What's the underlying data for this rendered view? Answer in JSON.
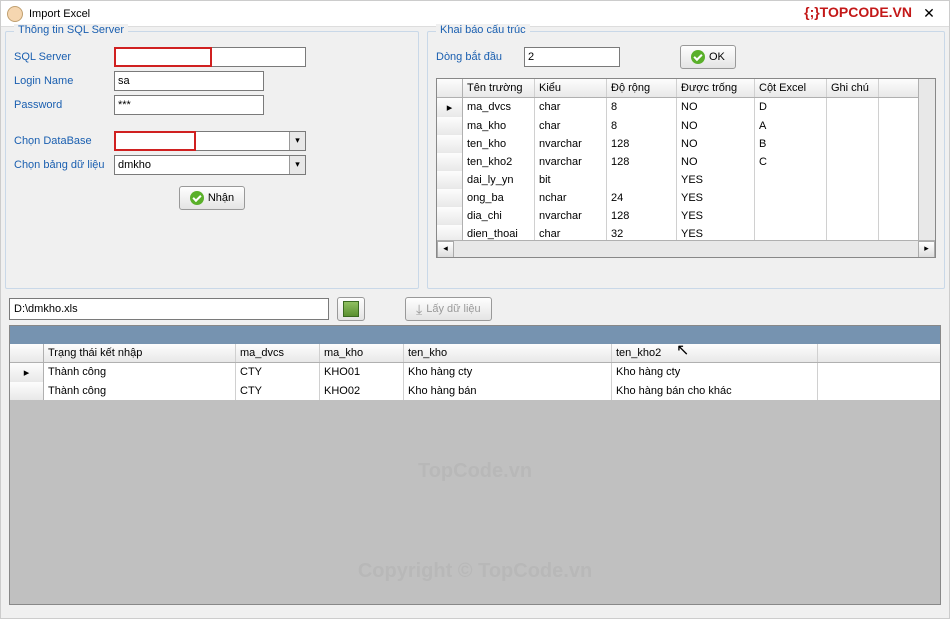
{
  "window": {
    "title": "Import Excel",
    "closeGlyph": "✕"
  },
  "logo": {
    "text": "{;}TOPCODE.VN"
  },
  "sql": {
    "groupTitle": "Thông tin SQL Server",
    "serverLabel": "SQL Server",
    "serverValue": "",
    "loginLabel": "Login Name",
    "loginValue": "sa",
    "passwordLabel": "Password",
    "passwordValue": "***",
    "dbLabel": "Chọn DataBase",
    "dbValue": "",
    "tableLabel": "Chọn bảng dữ liệu",
    "tableValue": "dmkho",
    "submitLabel": "Nhận"
  },
  "struct": {
    "groupTitle": "Khai báo cấu trúc",
    "startRowLabel": "Dòng bắt đầu",
    "startRowValue": "2",
    "okLabel": "OK",
    "headers": {
      "field": "Tên trường",
      "type": "Kiểu",
      "width": "Độ rộng",
      "nullable": "Được trống",
      "col": "Cột Excel",
      "note": "Ghi chú"
    },
    "rows": [
      {
        "field": "ma_dvcs",
        "type": "char",
        "width": "8",
        "nullable": "NO",
        "col": "D"
      },
      {
        "field": "ma_kho",
        "type": "char",
        "width": "8",
        "nullable": "NO",
        "col": "A"
      },
      {
        "field": "ten_kho",
        "type": "nvarchar",
        "width": "128",
        "nullable": "NO",
        "col": "B"
      },
      {
        "field": "ten_kho2",
        "type": "nvarchar",
        "width": "128",
        "nullable": "NO",
        "col": "C"
      },
      {
        "field": "dai_ly_yn",
        "type": "bit",
        "width": "",
        "nullable": "YES",
        "col": ""
      },
      {
        "field": "ong_ba",
        "type": "nchar",
        "width": "24",
        "nullable": "YES",
        "col": ""
      },
      {
        "field": "dia_chi",
        "type": "nvarchar",
        "width": "128",
        "nullable": "YES",
        "col": ""
      },
      {
        "field": "dien_thoai",
        "type": "char",
        "width": "32",
        "nullable": "YES",
        "col": ""
      }
    ]
  },
  "file": {
    "path": "D:\\dmkho.xls",
    "loadLabel": "Lấy dữ liệu"
  },
  "result": {
    "headers": {
      "status": "Trạng thái kết nhập",
      "ma_dvcs": "ma_dvcs",
      "ma_kho": "ma_kho",
      "ten_kho": "ten_kho",
      "ten_kho2": "ten_kho2"
    },
    "rows": [
      {
        "status": "Thành công",
        "ma_dvcs": "CTY",
        "ma_kho": "KHO01",
        "ten_kho": "Kho hàng cty",
        "ten_kho2": "Kho hàng  cty"
      },
      {
        "status": "Thành công",
        "ma_dvcs": "CTY",
        "ma_kho": "KHO02",
        "ten_kho": "Kho hàng bán",
        "ten_kho2": "Kho hàng bán cho khác"
      }
    ]
  },
  "watermark": {
    "center": "TopCode.vn",
    "copy": "Copyright © TopCode.vn"
  }
}
